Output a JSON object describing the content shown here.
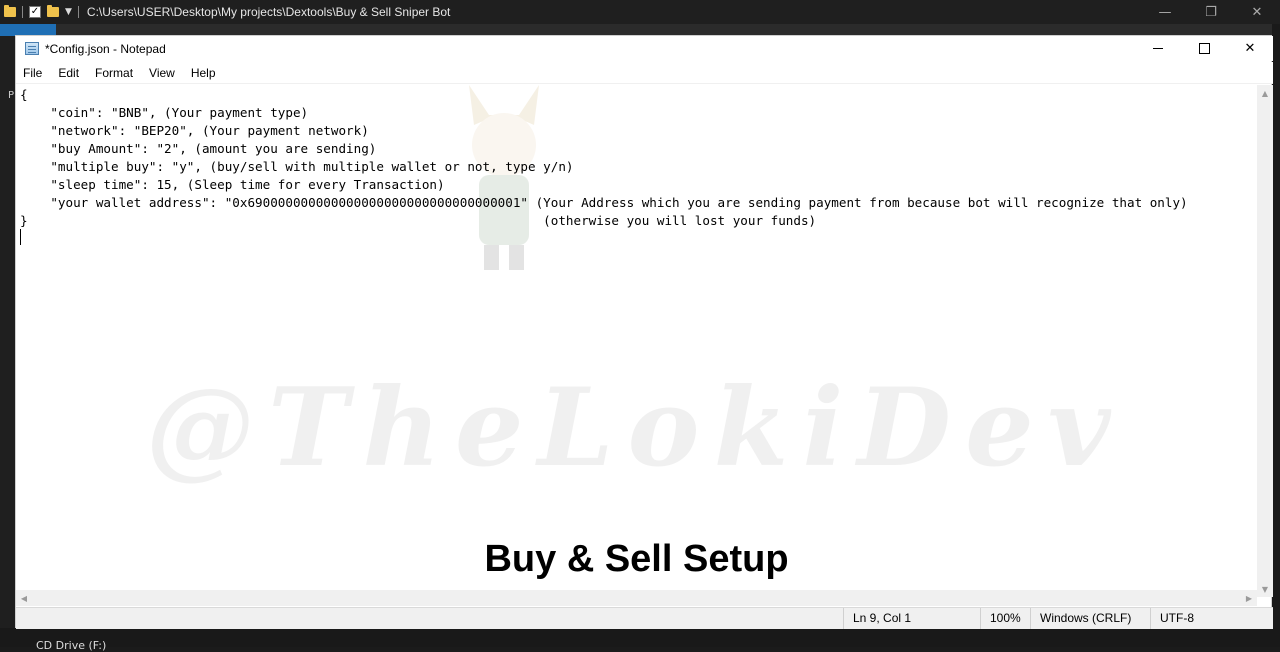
{
  "explorer": {
    "path": "C:\\Users\\USER\\Desktop\\My projects\\Dextools\\Buy & Sell Sniper Bot",
    "drive_label": "CD Drive (F:)",
    "left_letter": "P"
  },
  "window": {
    "title": "*Config.json - Notepad"
  },
  "menu": {
    "file": "File",
    "edit": "Edit",
    "format": "Format",
    "view": "View",
    "help": "Help"
  },
  "editor": {
    "lines": [
      "{",
      "    \"coin\": \"BNB\", (Your payment type)",
      "    \"network\": \"BEP20\", (Your payment network)",
      "    \"buy Amount\": \"2\", (amount you are sending)",
      "    \"multiple buy\": \"y\", (buy/sell with multiple wallet or not, type y/n)",
      "    \"sleep time\": 15, (Sleep time for every Transaction)",
      "    \"your wallet address\": \"0x690000000000000000000000000000000001\" (Your Address which you are sending payment from because bot will recognize that only)",
      "}                                                                    (otherwise you will lost your funds)",
      ""
    ]
  },
  "watermark": {
    "text": "@TheLokiDev"
  },
  "overlay": {
    "title": "Buy & Sell Setup"
  },
  "status": {
    "position": "Ln 9, Col 1",
    "zoom": "100%",
    "line_ending": "Windows (CRLF)",
    "encoding": "UTF-8"
  }
}
